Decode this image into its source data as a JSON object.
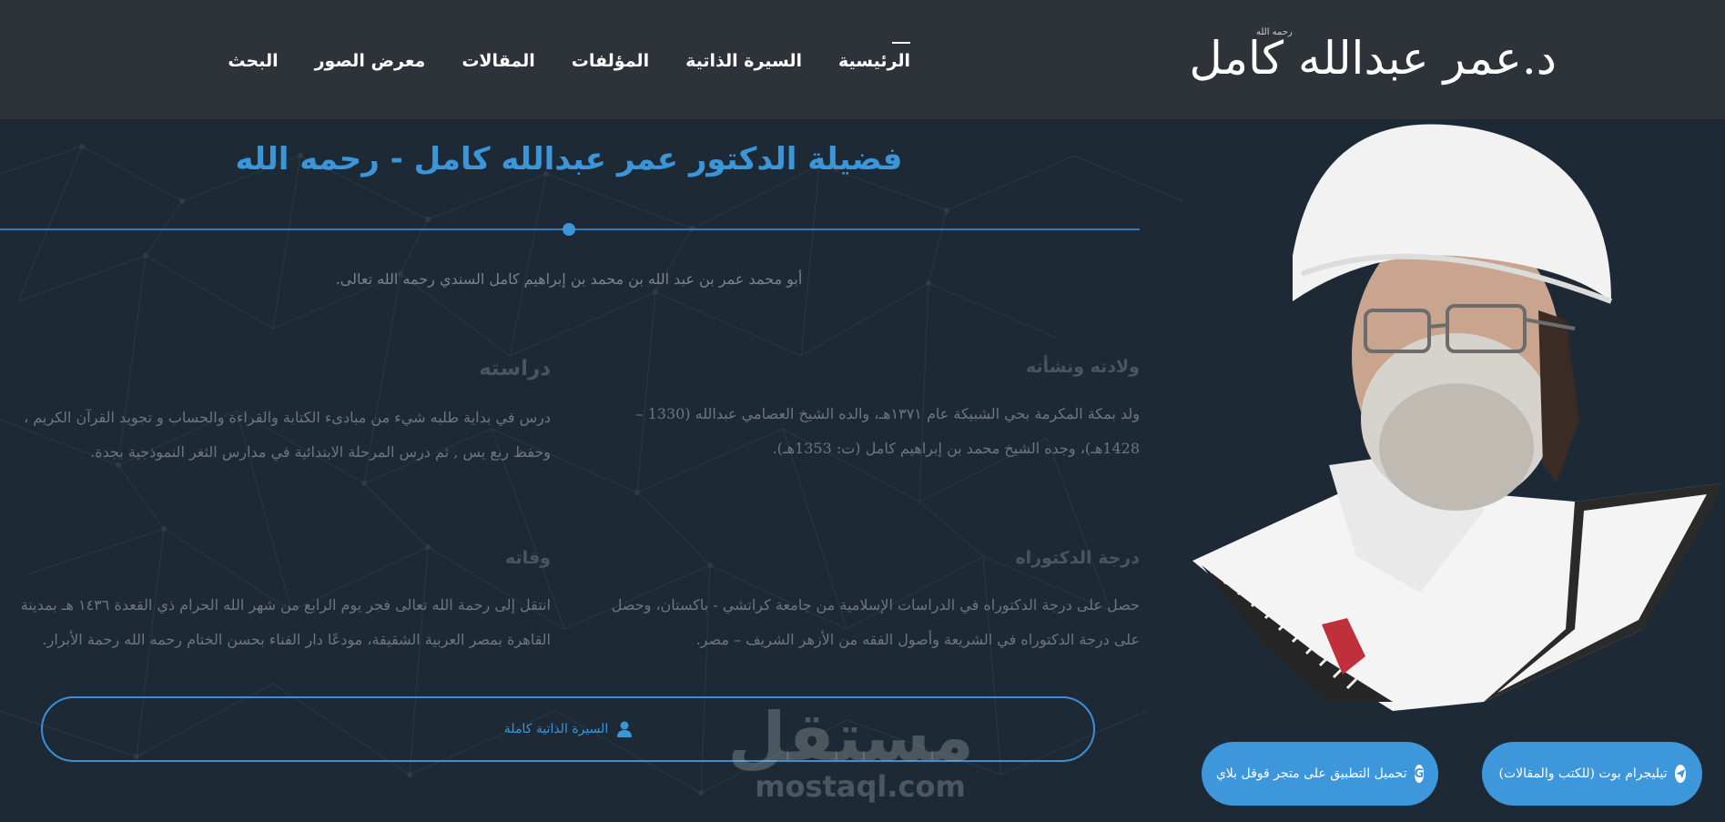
{
  "header": {
    "logo_text": "د.عمر عبدالله كامل",
    "logo_small": "رحمه الله",
    "nav": [
      {
        "label": "الرئيسية",
        "active": true
      },
      {
        "label": "السيرة الذاتية"
      },
      {
        "label": "المؤلفات"
      },
      {
        "label": "المقالات"
      },
      {
        "label": "معرض الصور"
      },
      {
        "label": "البحث"
      }
    ]
  },
  "main": {
    "title": "فضيلة الدكتور عمر عبدالله كامل - رحمه الله",
    "intro": "أبو محمد عمر بن عبد الله بن محمد بن إبراهيم كامل السندي رحمه الله تعالى.",
    "sections": {
      "birth": {
        "heading": "ولادته ونشأته",
        "text": "ولد بمكة المكرمة بحي الشبيكة عام ١٣٧١هـ، والده الشيخ العصامي عبدالله (1330 – 1428هـ)، وجده الشيخ محمد بن إبراهيم كامل (ت: 1353هـ)."
      },
      "study": {
        "heading": "دراسته",
        "text": "درس في بداية طلبه شيء من مبادىء الكتابة والقراءة والحساب و تجويد القرآن الكريم ، وحفظ ربع يس , ثم درس المرحلة الابتدائية في مدارس الثغر النموذجية بجدة."
      },
      "doctorate": {
        "heading": "درجة الدكتوراه",
        "text": "حصل على درجة الدكتوراه في الدراسات الإسلامية من جامعة كراتشي - باكستان، وحصل على درجة الدكتوراه في الشريعة وأصول الفقه من الأزهر الشريف – مصر."
      },
      "death": {
        "heading": "وفاته",
        "text": "انتقل إلى رحمة الله تعالى فجر يوم الرابع من شهر الله الحرام ذي القعدة ١٤٣٦ هـ بمدينة القاهرة بمصر العربية الشقيقة، مودعًا دار الفناء بحسن الختام رحمه الله رحمة الأبرار."
      }
    },
    "bio_button_label": "السيرة الذاتية كاملة"
  },
  "watermark": {
    "arabic": "مستقل",
    "latin": "mostaql.com"
  },
  "buttons": {
    "telegram_label": "تيليجرام بوت (للكتب والمقالات)",
    "google_label": "تحميل التطبيق على متجر قوقل بلاي"
  },
  "colors": {
    "header_bg": "#2d3339",
    "page_bg": "#1d2a36",
    "accent": "#3b95d9"
  },
  "icons": {
    "user": "user-icon",
    "telegram": "telegram-icon",
    "google": "google-icon"
  }
}
